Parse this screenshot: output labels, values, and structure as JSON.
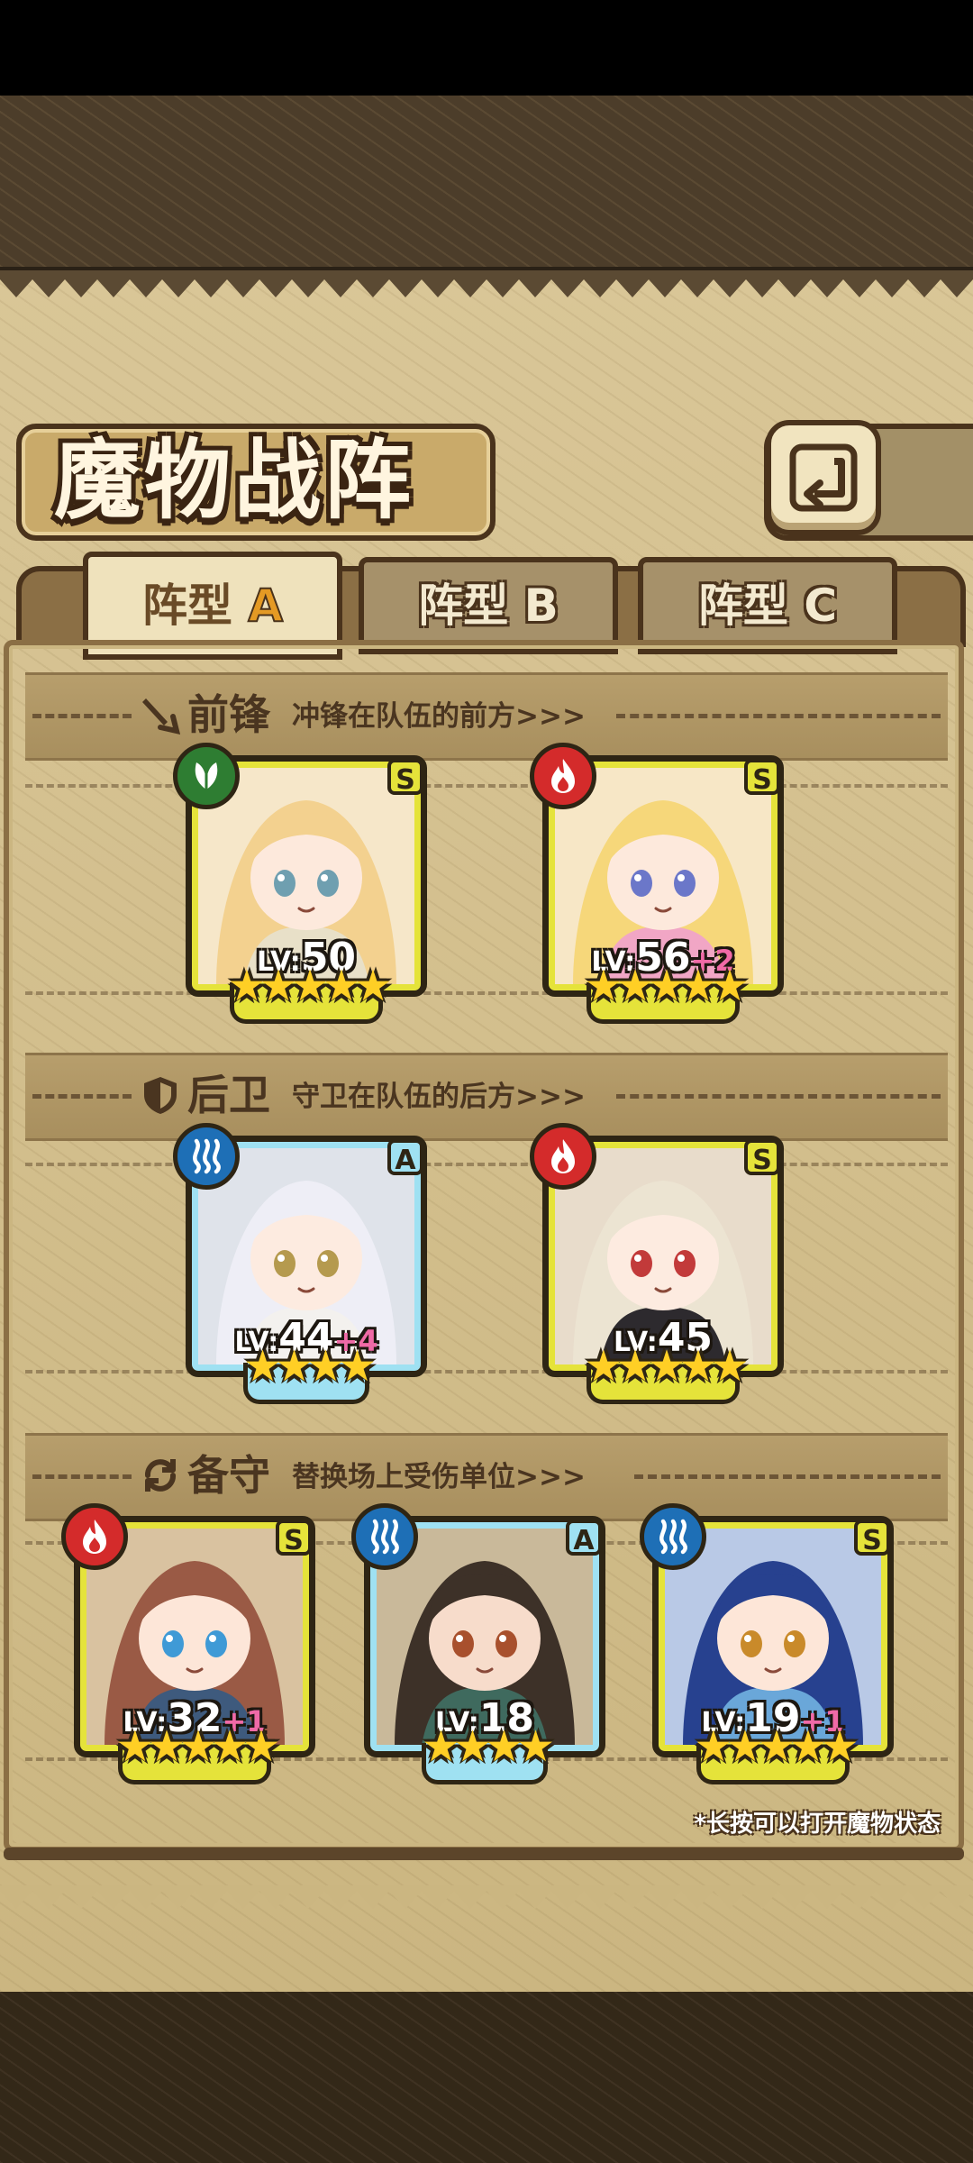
{
  "screen_title": "魔物战阵",
  "tabs": [
    {
      "label": "阵型",
      "letter": "A",
      "active": true
    },
    {
      "label": "阵型",
      "letter": "B",
      "active": false
    },
    {
      "label": "阵型",
      "letter": "C",
      "active": false
    }
  ],
  "sections": {
    "front": {
      "name": "前锋",
      "desc": "冲锋在队伍的前方>>>",
      "icon": "sword-icon"
    },
    "rear": {
      "name": "后卫",
      "desc": "守卫在队伍的后方>>>",
      "icon": "shield-icon"
    },
    "reserve": {
      "name": "备守",
      "desc": "替换场上受伤单位>>>",
      "icon": "swap-icon"
    }
  },
  "cards": [
    {
      "section": "front",
      "element": "nature",
      "rank": "S",
      "level": "50",
      "bonus": "",
      "stars": 5,
      "palette": "blonde-green"
    },
    {
      "section": "front",
      "element": "fire",
      "rank": "S",
      "level": "56",
      "bonus": "+2",
      "stars": 5,
      "palette": "blonde-pink"
    },
    {
      "section": "rear",
      "element": "water",
      "rank": "A",
      "level": "44",
      "bonus": "+4",
      "stars": 4,
      "palette": "silver-white"
    },
    {
      "section": "rear",
      "element": "fire",
      "rank": "S",
      "level": "45",
      "bonus": "",
      "stars": 5,
      "palette": "cream-dark"
    },
    {
      "section": "reserve",
      "element": "fire",
      "rank": "S",
      "level": "32",
      "bonus": "+1",
      "stars": 5,
      "palette": "brown-witch"
    },
    {
      "section": "reserve",
      "element": "water",
      "rank": "A",
      "level": "18",
      "bonus": "",
      "stars": 4,
      "palette": "dark-green"
    },
    {
      "section": "reserve",
      "element": "water",
      "rank": "S",
      "level": "19",
      "bonus": "+1",
      "stars": 5,
      "palette": "navy-elf"
    }
  ],
  "lv_prefix": "LV:",
  "hint": "*长按可以打开魔物状态",
  "colors": {
    "rank_S": "#e5e33a",
    "rank_A": "#9fe1f2",
    "fire": "#d42b2b",
    "water": "#1e6fb6",
    "nature": "#2e7d32",
    "accent_letter": "#e49a24",
    "bonus": "#f06aa7"
  }
}
